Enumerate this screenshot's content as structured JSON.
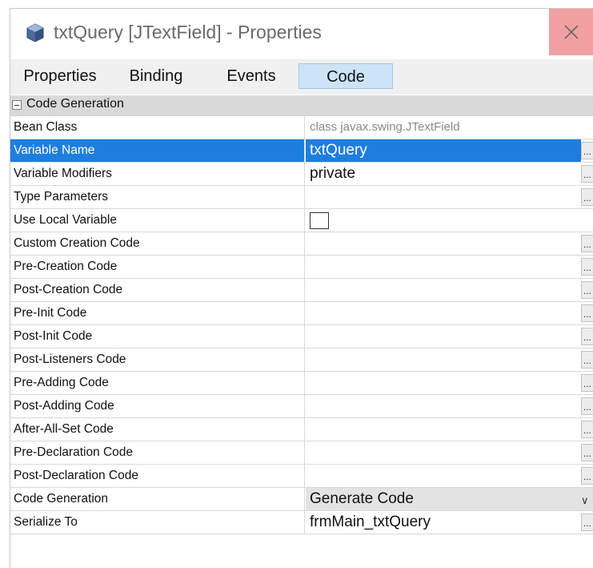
{
  "window": {
    "title": "txtQuery [JTextField] - Properties",
    "close_label": "✕"
  },
  "tabs": [
    {
      "label": "Properties"
    },
    {
      "label": "Binding"
    },
    {
      "label": "Events"
    },
    {
      "label": "Code"
    }
  ],
  "active_tab": "Code",
  "section": {
    "title": "Code Generation"
  },
  "rows": [
    {
      "name": "Bean Class",
      "value": "class javax.swing.JTextField"
    },
    {
      "name": "Variable Name",
      "value": "txtQuery"
    },
    {
      "name": "Variable Modifiers",
      "value": "private"
    },
    {
      "name": "Type Parameters",
      "value": ""
    },
    {
      "name": "Use Local Variable",
      "value": ""
    },
    {
      "name": "Custom Creation Code",
      "value": ""
    },
    {
      "name": "Pre-Creation Code",
      "value": ""
    },
    {
      "name": "Post-Creation Code",
      "value": ""
    },
    {
      "name": "Pre-Init Code",
      "value": ""
    },
    {
      "name": "Post-Init Code",
      "value": ""
    },
    {
      "name": "Post-Listeners Code",
      "value": ""
    },
    {
      "name": "Pre-Adding Code",
      "value": ""
    },
    {
      "name": "Post-Adding Code",
      "value": ""
    },
    {
      "name": "After-All-Set Code",
      "value": ""
    },
    {
      "name": "Pre-Declaration Code",
      "value": ""
    },
    {
      "name": "Post-Declaration Code",
      "value": ""
    },
    {
      "name": "Code Generation",
      "value": "Generate Code"
    },
    {
      "name": "Serialize To",
      "value": "frmMain_txtQuery"
    }
  ],
  "ellipsis_label": "...",
  "dropdown_arrow": "∨",
  "colors": {
    "selection": "#1e7ee0",
    "active_tab": "#cde4f7",
    "close_hover": "#f0a0a0"
  }
}
